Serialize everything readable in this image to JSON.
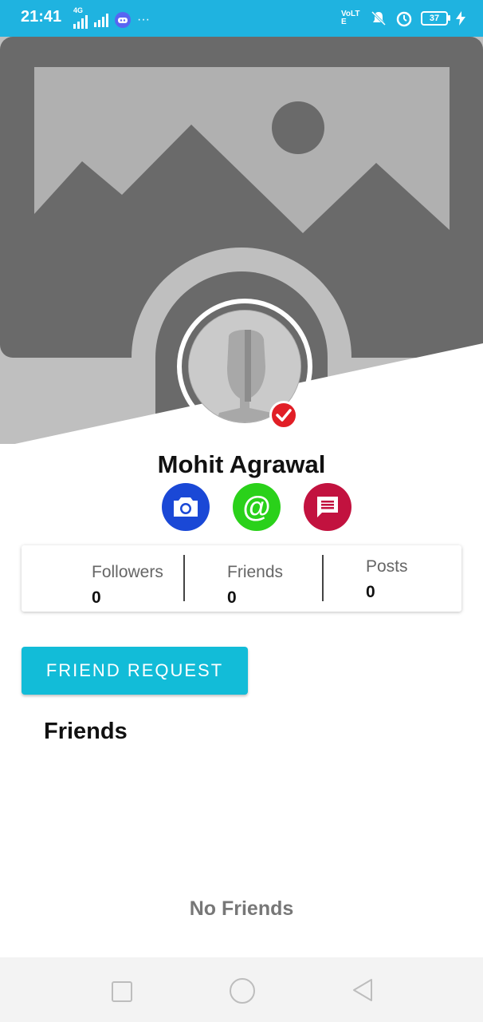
{
  "status_bar": {
    "time": "21:41",
    "network_label": "4G",
    "volte_label": "VoLTE",
    "battery_level": "37",
    "icons": [
      "signal-icon",
      "discord-icon",
      "more-dots-icon",
      "mute-icon",
      "alarm-icon",
      "battery-icon",
      "charging-icon"
    ]
  },
  "profile": {
    "name": "Mohit Agrawal",
    "verified": true
  },
  "actions": {
    "camera": "camera-icon",
    "mention": "@",
    "chat": "chat-icon"
  },
  "stats": {
    "followers_label": "Followers",
    "followers_value": "0",
    "friends_label": "Friends",
    "friends_value": "0",
    "posts_label": "Posts",
    "posts_value": "0"
  },
  "buttons": {
    "friend_request": "FRIEND REQUEST"
  },
  "friends_section": {
    "title": "Friends",
    "empty_text": "No Friends"
  },
  "colors": {
    "status_bar": "#1fb3e0",
    "camera_button": "#1a48d6",
    "mention_button": "#2ad11a",
    "chat_button": "#c2123f",
    "verified_badge": "#e11e26",
    "friend_request_button": "#12bcd8"
  }
}
